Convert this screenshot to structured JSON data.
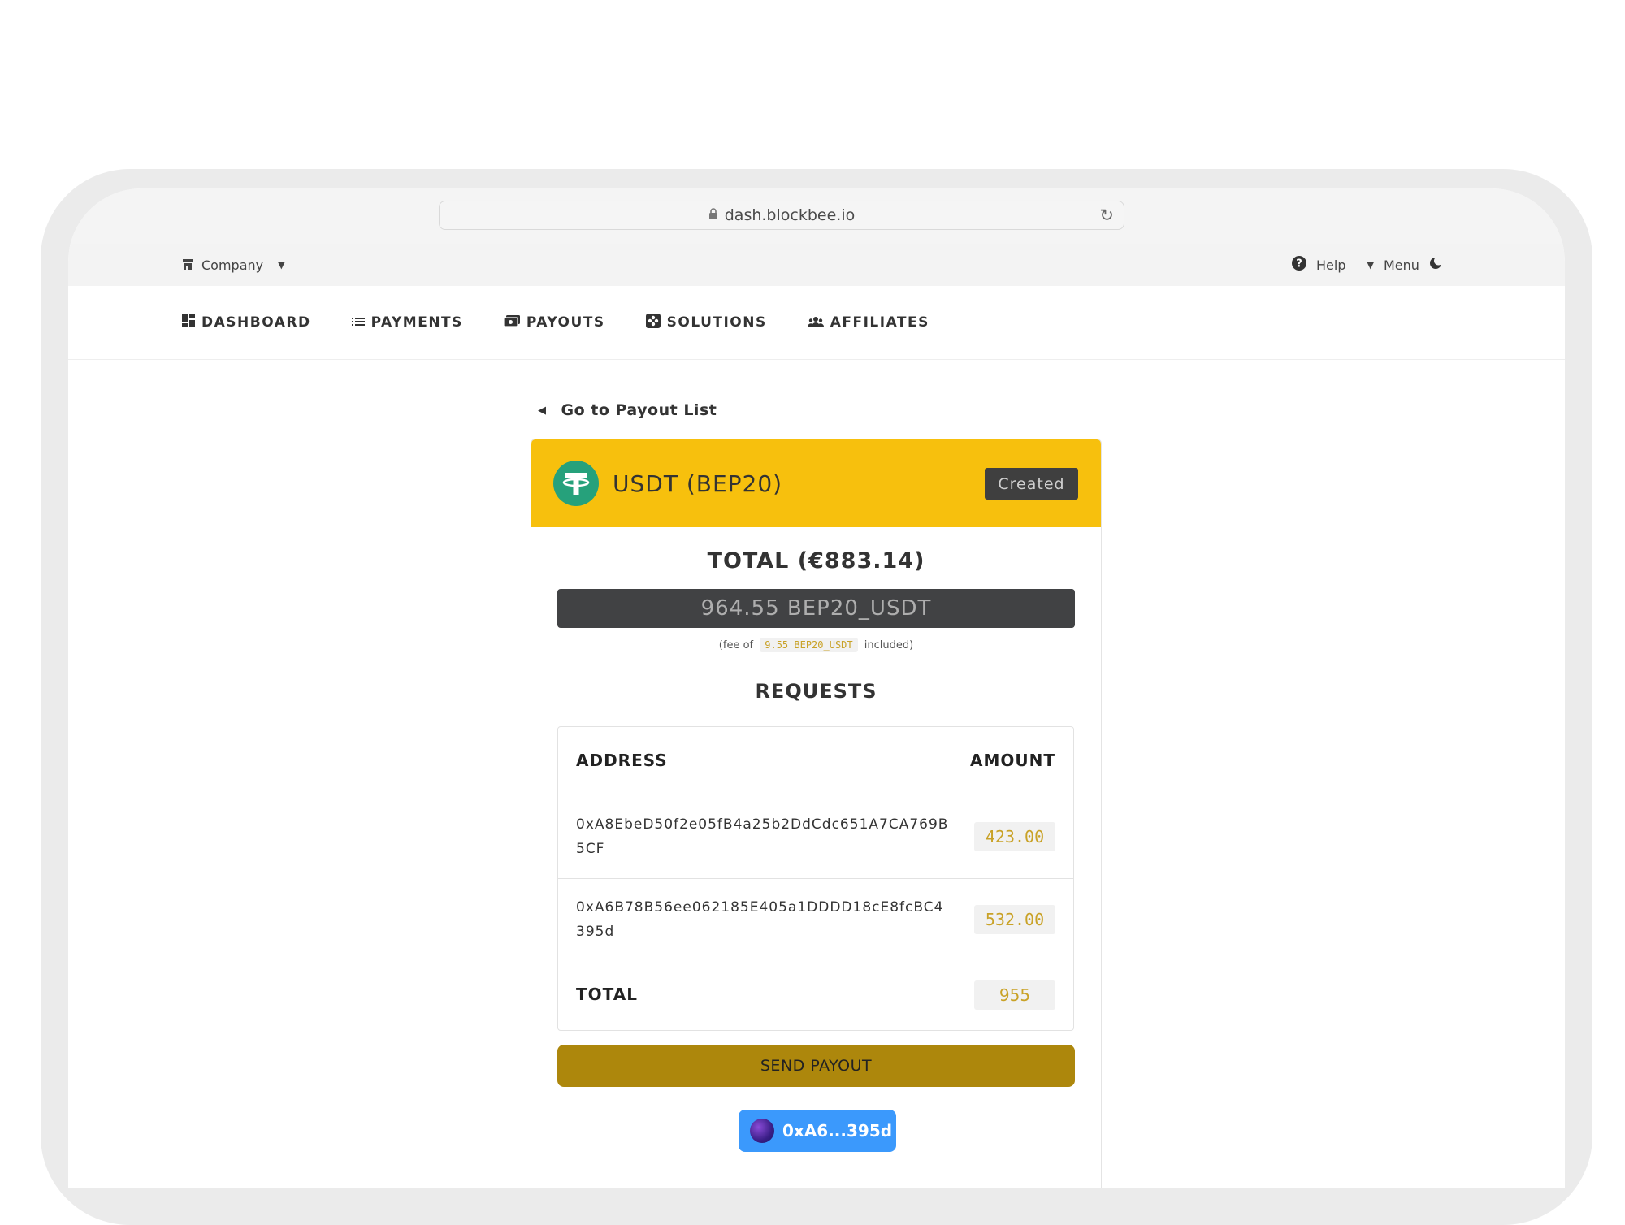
{
  "browser": {
    "url": "dash.blockbee.io"
  },
  "topbar": {
    "company": "Company",
    "help": "Help",
    "menu": "Menu"
  },
  "nav": {
    "items": [
      {
        "label": "DASHBOARD",
        "icon": "dashboard-icon"
      },
      {
        "label": "PAYMENTS",
        "icon": "list-icon"
      },
      {
        "label": "PAYOUTS",
        "icon": "money-icon"
      },
      {
        "label": "SOLUTIONS",
        "icon": "puzzle-icon"
      },
      {
        "label": "AFFILIATES",
        "icon": "users-icon"
      }
    ]
  },
  "back_link": "Go to Payout List",
  "payout": {
    "coin": "USDT (BEP20)",
    "status": "Created",
    "total_title": "TOTAL (€883.14)",
    "total_amount": "964.55 BEP20_USDT",
    "fee_prefix": "(fee of",
    "fee_value": "9.55 BEP20_USDT",
    "fee_suffix": "included)",
    "requests_title": "REQUESTS",
    "table": {
      "headers": {
        "address": "ADDRESS",
        "amount": "AMOUNT"
      },
      "rows": [
        {
          "address": "0xA8EbeD50f2e05fB4a25b2DdCdc651A7CA769B5CF",
          "amount": "423.00"
        },
        {
          "address": "0xA6B78B56ee062185E405a1DDDD18cE8fcBC4395d",
          "amount": "532.00"
        }
      ],
      "total_label": "TOTAL",
      "total_value": "955"
    },
    "send_button": "SEND PAYOUT",
    "wallet": "0xA6...395d"
  },
  "colors": {
    "header_yellow": "#f7c00d",
    "send_button": "#ad870c",
    "wallet_button": "#3b99fc",
    "tether_green": "#26a17b"
  }
}
